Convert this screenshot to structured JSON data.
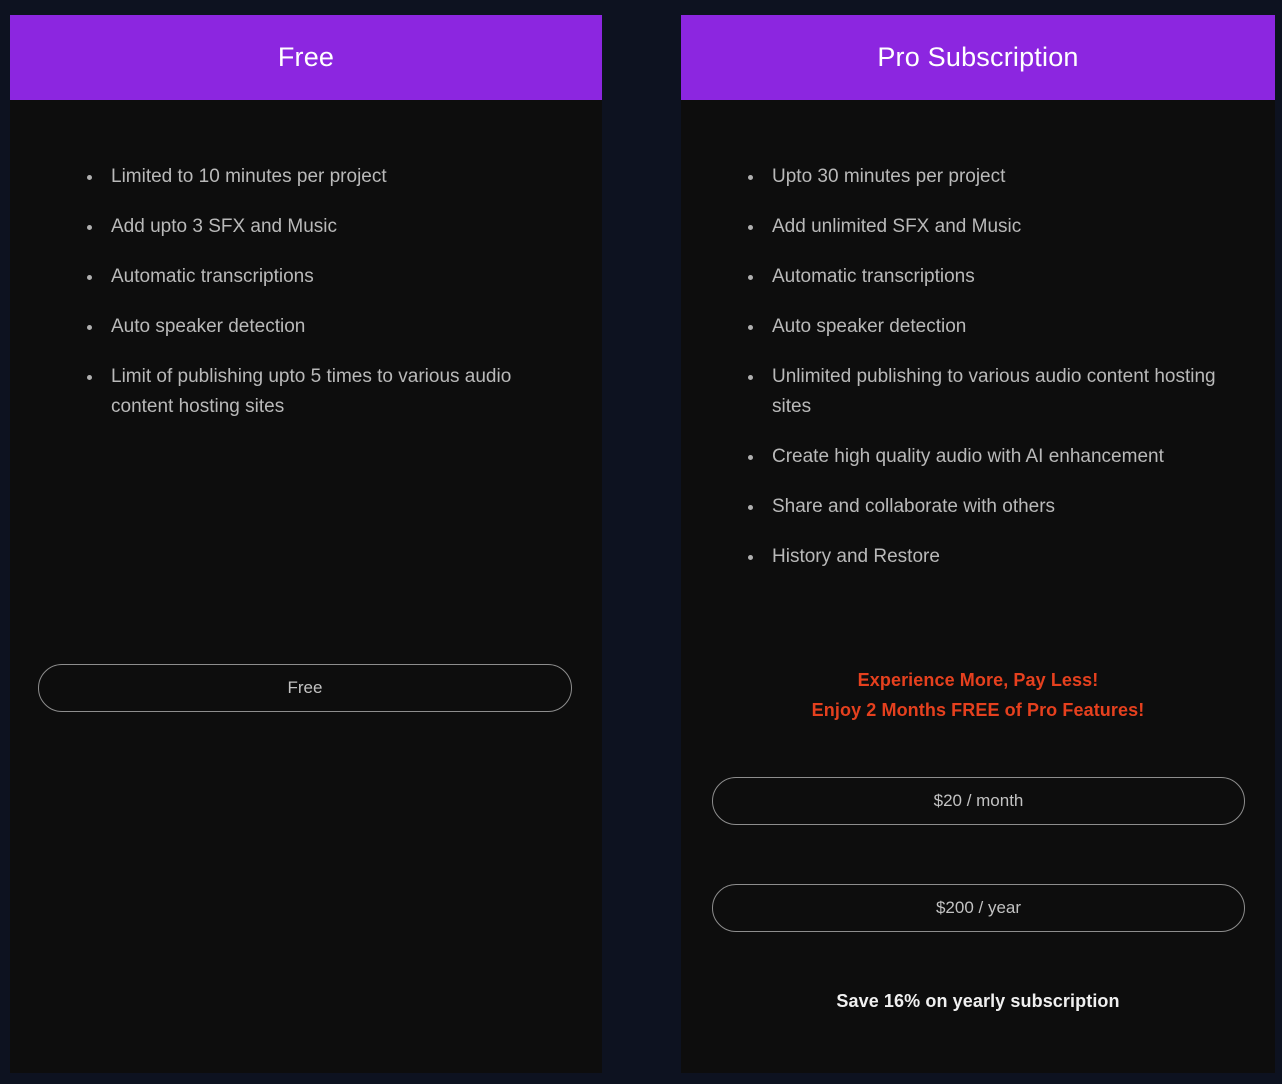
{
  "theme": {
    "page_background": "#0d1220",
    "card_background": "#0d0d0d",
    "header_purple": "#8c26e0",
    "feature_text": "#b9b9b9",
    "button_border": "#8d8d8d",
    "promo_accent": "#e5401e",
    "save_note_color": "#f0f0f0"
  },
  "plans": {
    "free": {
      "title": "Free",
      "features": [
        "Limited to 10 minutes per project",
        "Add upto 3 SFX and Music",
        "Automatic transcriptions",
        "Auto speaker detection",
        "Limit of publishing upto 5 times to various audio content hosting sites"
      ],
      "cta_label": "Free"
    },
    "pro": {
      "title": "Pro Subscription",
      "features": [
        "Upto 30 minutes per project",
        "Add unlimited SFX and Music",
        "Automatic transcriptions",
        "Auto speaker detection",
        "Unlimited publishing to various audio content hosting sites",
        "Create high quality audio with AI enhancement",
        "Share and collaborate with others",
        "History and Restore"
      ],
      "promo_line_1": "Experience More, Pay Less!",
      "promo_line_2": "Enjoy 2 Months FREE of Pro Features!",
      "monthly_label": "$20 / month",
      "yearly_label": "$200 / year",
      "save_note": "Save 16% on yearly subscription"
    }
  }
}
